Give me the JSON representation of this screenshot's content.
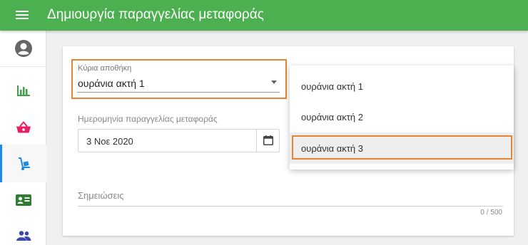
{
  "header": {
    "title": "Δημιουργία παραγγελίας μεταφοράς",
    "menu_icon": "menu-icon",
    "color": "#4caf50"
  },
  "sidebar": {
    "items": [
      {
        "name": "account",
        "icon": "account-circle-icon",
        "color": "#666666"
      },
      {
        "name": "reports",
        "icon": "bar-chart-icon",
        "color": "#43a047"
      },
      {
        "name": "orders",
        "icon": "basket-icon",
        "color": "#e91e63"
      },
      {
        "name": "transfers",
        "icon": "hand-truck-icon",
        "color": "#1e88e5",
        "active": true
      },
      {
        "name": "contacts",
        "icon": "id-card-icon",
        "color": "#2e7d32"
      },
      {
        "name": "users",
        "icon": "people-icon",
        "color": "#3949ab"
      }
    ]
  },
  "form": {
    "warehouse": {
      "label": "Κύρια αποθήκη",
      "value": "ουράνια ακτή 1"
    },
    "date": {
      "label": "Ημερομηνία παραγγελίας μεταφοράς",
      "value": "3 Νοε 2020",
      "icon": "calendar-icon"
    },
    "notes": {
      "placeholder": "Σημειώσεις",
      "counter": "0 / 500"
    }
  },
  "dropdown": {
    "options": [
      "ουράνια ακτή 1",
      "ουράνια ακτή 2",
      "ουράνια ακτή 3"
    ],
    "highlighted_index": 2
  },
  "colors": {
    "highlight_outline": "#e8832f"
  }
}
